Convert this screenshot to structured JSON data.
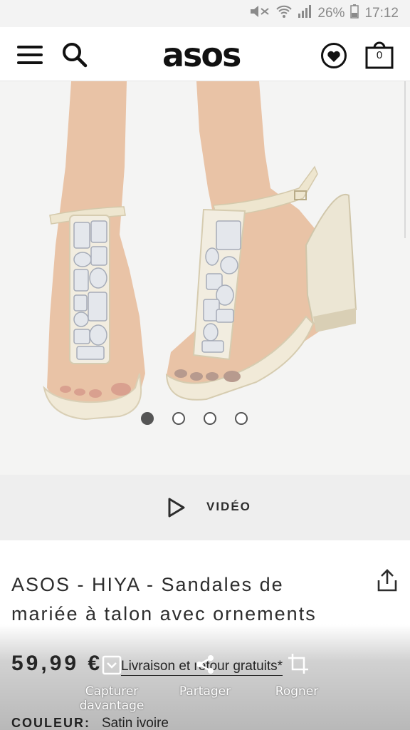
{
  "status_bar": {
    "battery": "26%",
    "time": "17:12"
  },
  "header": {
    "logo": "asos",
    "bag_count": "0",
    "icons": [
      "menu-icon",
      "search-icon",
      "saved-items-icon",
      "bag-icon"
    ]
  },
  "gallery": {
    "dot_count": 4,
    "active_index": 0
  },
  "video": {
    "label": "VIDÉO"
  },
  "product": {
    "title": "ASOS - HIYA - Sandales de mariée à talon avec ornements",
    "price": "59,99 €",
    "delivery": "Livraison et retour gratuits*",
    "color_label": "COULEUR:",
    "color_value": "Satin ivoire"
  },
  "screenshot_overlay": {
    "capture_more": "Capturer davantage",
    "share": "Partager",
    "crop": "Rogner"
  },
  "colors": {
    "text": "#2d2d2d",
    "status_bar_bg": "#f3f3f3",
    "video_bar_bg": "#eeeeee",
    "gallery_bg": "#f4f4f3"
  }
}
